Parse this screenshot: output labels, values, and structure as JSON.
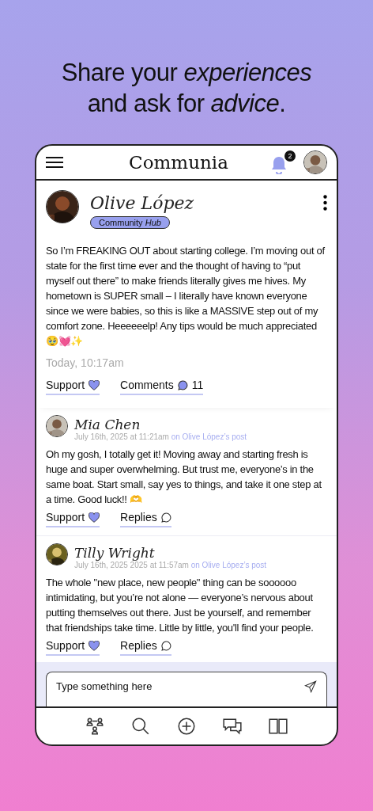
{
  "headline": {
    "line_1": "Share your *experiences*",
    "line_2": "and ask for *advice*."
  },
  "app_bar": {
    "logo": "Communia",
    "notification_count": "2"
  },
  "post": {
    "author": "Olive López",
    "badge": "Community *Hub*",
    "body": "So I’m FREAKING OUT about starting college. I’m moving out of state for the first time ever and the thought of having to “put myself out there” to make friends literally gives me hives. My hometown is SUPER small – I literally have known everyone since we were babies, so this is like a MASSIVE step out of my comfort zone. Heeeeeelp! Any tips would be much appreciated 🥹💓✨",
    "time": "Today, 10:17am",
    "support_label": "Support",
    "comments_label": "Comments",
    "comments_count": "11"
  },
  "comments": [
    {
      "author": "Mia Chen",
      "meta": "July 16th, 2025 at 11:21am",
      "context": "on Olive López’s post",
      "body": "Oh my gosh, I totally get it! Moving away and starting fresh is huge and super overwhelming. But trust me, everyone’s in the same boat. Start small, say yes to things, and take it one step at a time. Good luck!! 🫶",
      "support_label": "Support",
      "replies_label": "Replies"
    },
    {
      "author": "Tilly Wright",
      "meta": "July 16th, 2025 2025 at 11:57am",
      "context": "on Olive López’s post",
      "body": "The whole \"new place, new people\" thing can be soooooo intimidating, but you’re not alone — everyone’s nervous about putting themselves out there. Just be yourself, and remember that friendships take time. Little by little, you'll find your people.",
      "support_label": "Support",
      "replies_label": "Replies"
    }
  ],
  "composer": {
    "placeholder": "Type something here"
  },
  "bottom_nav": [
    {
      "kind": "community"
    },
    {
      "kind": "search"
    },
    {
      "kind": "add"
    },
    {
      "kind": "chat"
    },
    {
      "kind": "book"
    }
  ]
}
